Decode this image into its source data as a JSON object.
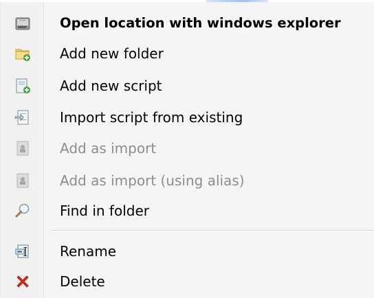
{
  "menu": {
    "items": [
      {
        "label": "Open location with windows explorer",
        "icon": "drive-icon",
        "enabled": true,
        "default": true
      },
      {
        "label": "Add new folder",
        "icon": "folder-add-icon",
        "enabled": true
      },
      {
        "label": "Add new script",
        "icon": "script-add-icon",
        "enabled": true
      },
      {
        "label": "Import script from existing",
        "icon": "import-script-icon",
        "enabled": true
      },
      {
        "label": "Add as import",
        "icon": "import-icon",
        "enabled": false
      },
      {
        "label": "Add as import (using alias)",
        "icon": "import-alias-icon",
        "enabled": false
      },
      {
        "label": "Find in folder",
        "icon": "magnifier-icon",
        "enabled": true
      },
      {
        "label": "Rename",
        "icon": "rename-icon",
        "enabled": true
      },
      {
        "label": "Delete",
        "icon": "delete-icon",
        "enabled": true
      }
    ]
  },
  "colors": {
    "menu_background": "#f5f5f5",
    "gutter_background": "#f1f1f1",
    "enabled_text": "#000000",
    "disabled_text": "#8d8d8d",
    "delete_red": "#d9281e",
    "add_green": "#3aa635"
  }
}
